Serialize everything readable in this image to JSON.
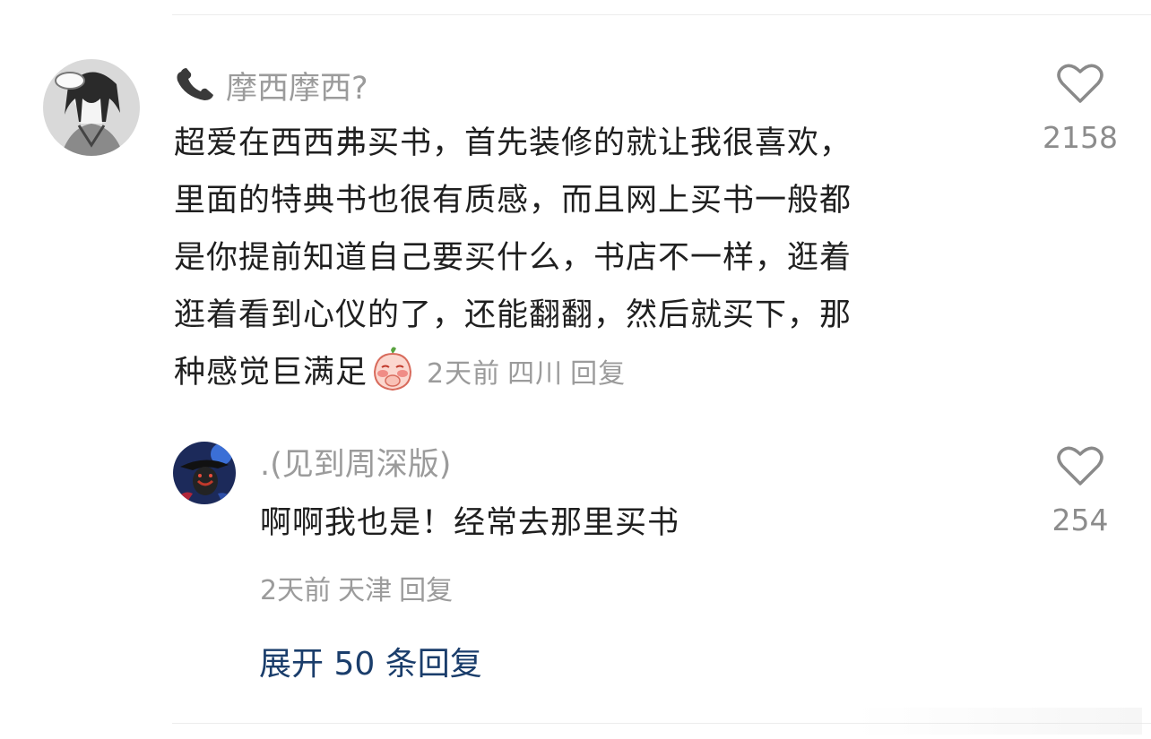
{
  "comment": {
    "user": "摩西摩西?",
    "lines": [
      "超爱在西西弗买书，首先装修的就让我很喜欢，",
      "里面的特典书也很有质感，而且网上买书一般都",
      "是你提前知道自己要买什么，书店不一样，逛着",
      "逛着看到心仪的了，还能翻翻，然后就买下，那",
      "种感觉巨满足"
    ],
    "time": "2天前",
    "location": "四川",
    "reply_label": "回复",
    "likes": "2158",
    "icons": {
      "phone": "phone-icon",
      "emoji": "blush-peach-emoji",
      "like": "heart-icon"
    }
  },
  "reply": {
    "user": ".(见到周深版)",
    "text": "啊啊我也是！经常去那里买书",
    "time": "2天前",
    "location": "天津",
    "reply_label": "回复",
    "likes": "254"
  },
  "expand_label": "展开 50 条回复"
}
